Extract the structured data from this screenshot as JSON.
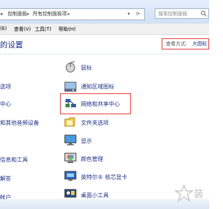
{
  "address": {
    "crumbs": [
      "控制面板",
      "所有控制面板项"
    ],
    "separator": "▸"
  },
  "search": {
    "placeholder": "搜索控制面板"
  },
  "menu": [
    "(E)",
    "查看(V)",
    "工具(T)",
    "帮助(H)"
  ],
  "header": {
    "title": "的设置",
    "view_label": "查看方式:",
    "view_value": "大图标"
  },
  "left_items": [
    "选项",
    "中心",
    "和其他音频设备",
    "信息和工具",
    "解答",
    "帐户"
  ],
  "right_items": [
    {
      "label": "鼠标",
      "icon": "mouse-icon"
    },
    {
      "label": "通知区域图标",
      "icon": "notification-area-icon"
    },
    {
      "label": "网络和共享中心",
      "icon": "network-sharing-icon"
    },
    {
      "label": "文件夹选项",
      "icon": "folder-options-icon"
    },
    {
      "label": "显示",
      "icon": "display-icon"
    },
    {
      "label": "颜色管理",
      "icon": "color-management-icon"
    },
    {
      "label": "英特尔® 核芯显卡",
      "icon": "intel-graphics-icon"
    },
    {
      "label": "桌面小工具",
      "icon": "desktop-gadgets-icon"
    }
  ],
  "watermark": {
    "text": "装"
  },
  "colors": {
    "link": "#1e3287",
    "highlight_border": "#e33b3b"
  }
}
